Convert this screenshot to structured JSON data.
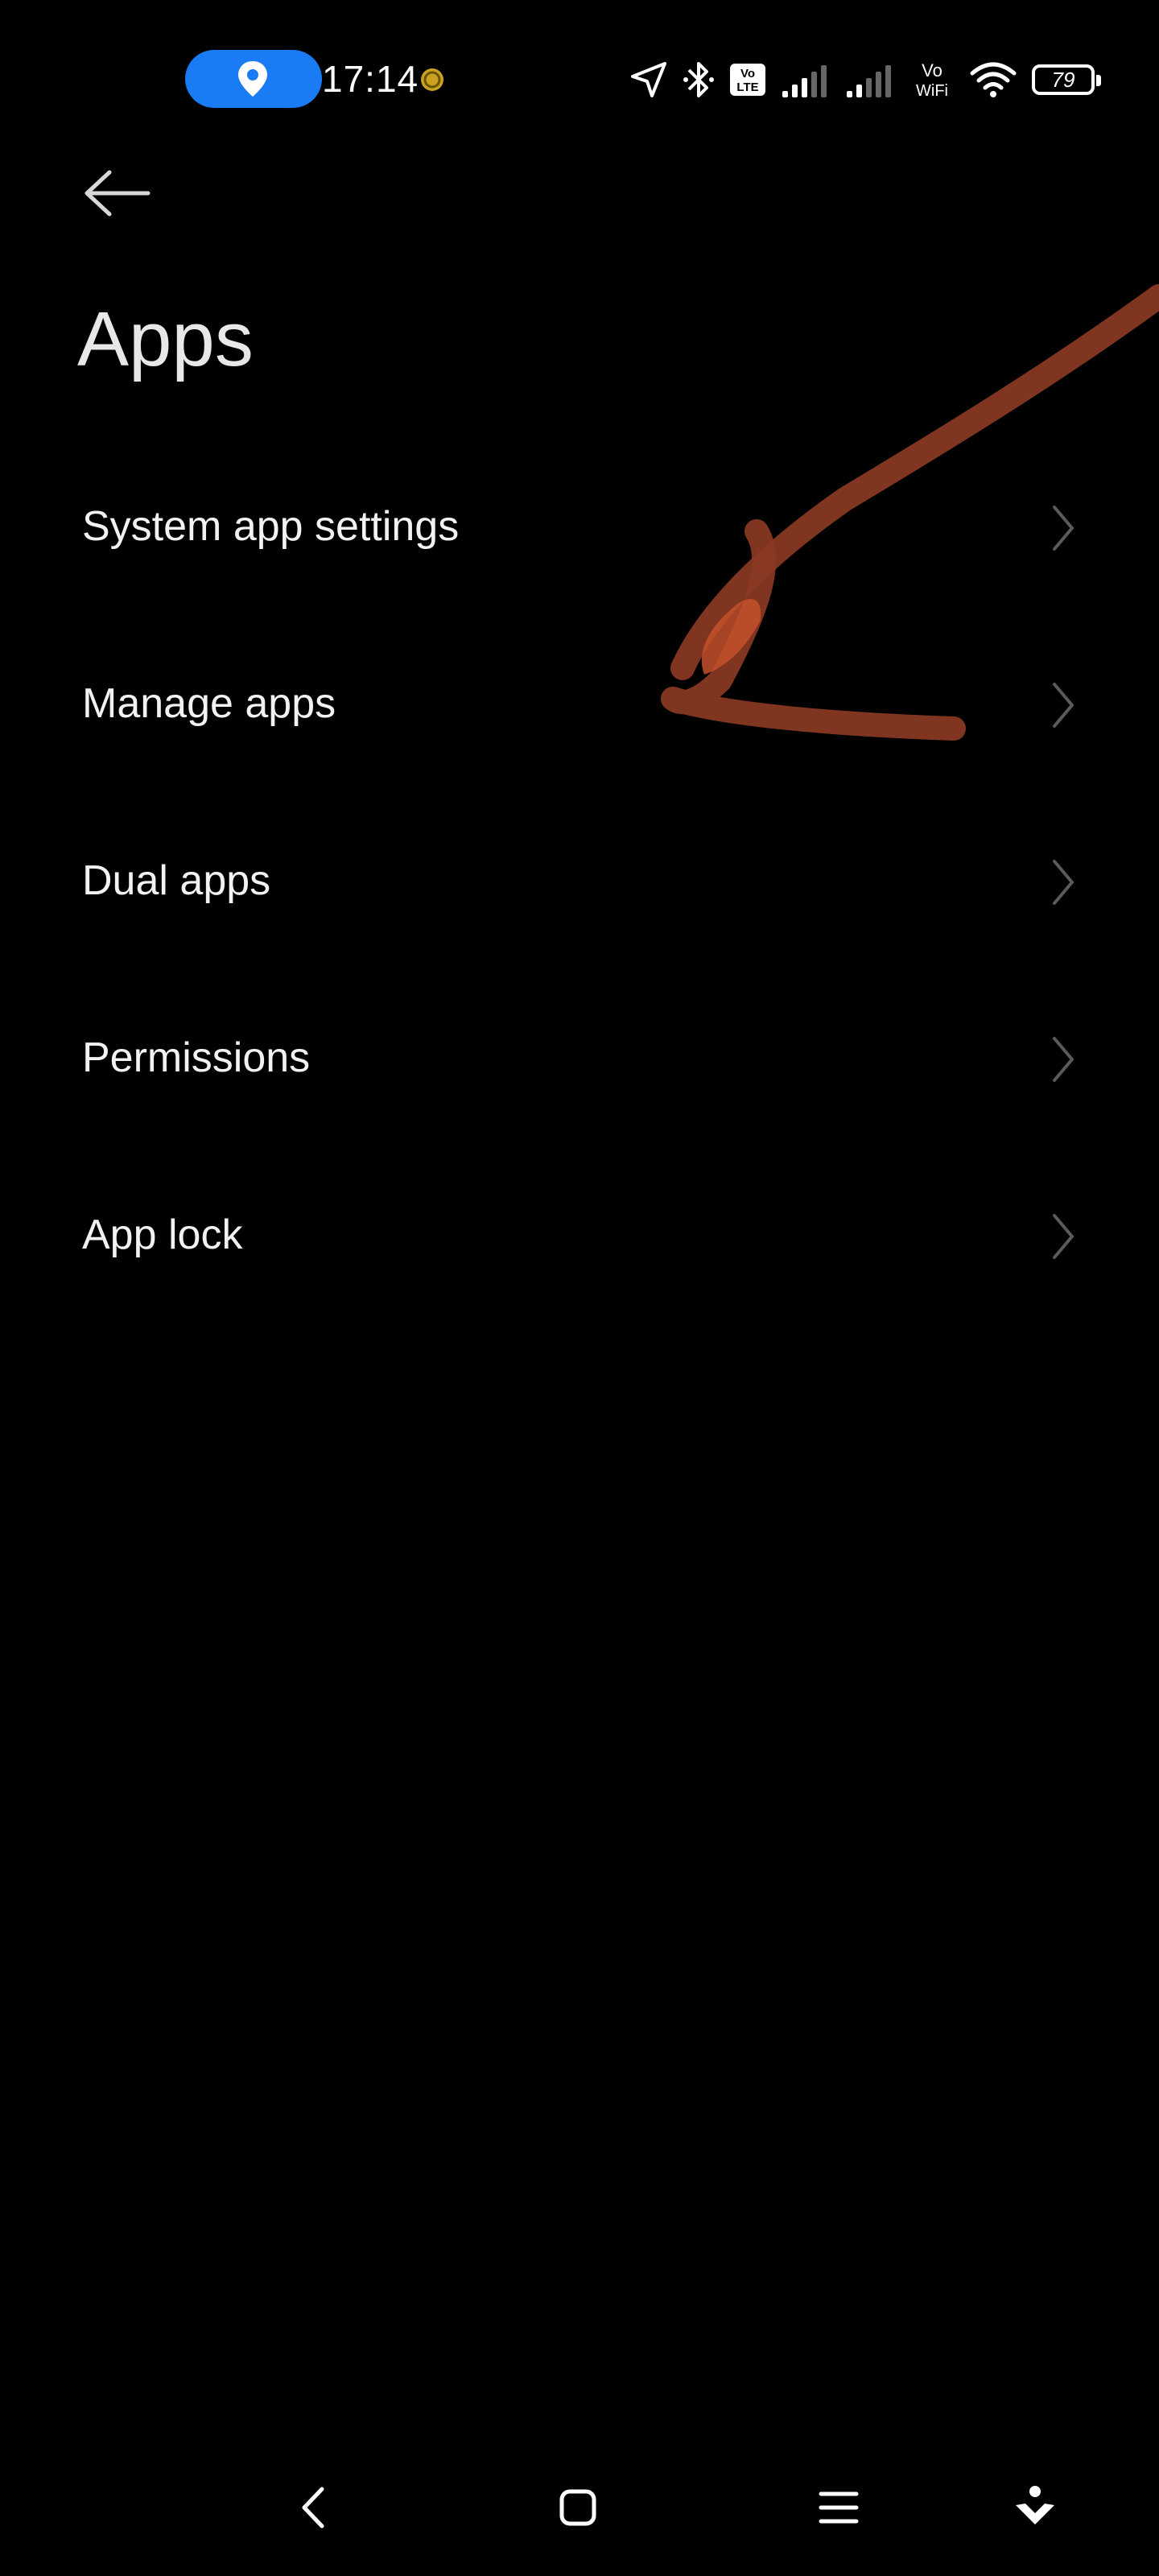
{
  "status_bar": {
    "time": "17:14",
    "battery_level": "79",
    "location_pill_color": "#1a7cf5",
    "icons": [
      "location-pin-icon",
      "coin-icon",
      "navigation-arrow-icon",
      "bluetooth-icon",
      "volte-icon",
      "signal-icon",
      "signal-icon",
      "vowifi-icon",
      "wifi-icon",
      "battery-icon"
    ],
    "volte_label": "Vo\nLTE",
    "vowifi_label": "Vo\nWiFi"
  },
  "header": {
    "back_icon": "arrow-left-icon",
    "title": "Apps"
  },
  "menu": {
    "items": [
      {
        "label": "System app settings"
      },
      {
        "label": "Manage apps"
      },
      {
        "label": "Dual apps"
      },
      {
        "label": "Permissions"
      },
      {
        "label": "App lock"
      }
    ]
  },
  "annotation": {
    "type": "hand-drawn arrow",
    "color": "#8a3a22",
    "points_to": "Manage apps"
  },
  "nav_bar": {
    "icons": [
      "back-icon",
      "home-icon",
      "menu-icon",
      "accessibility-icon"
    ]
  }
}
